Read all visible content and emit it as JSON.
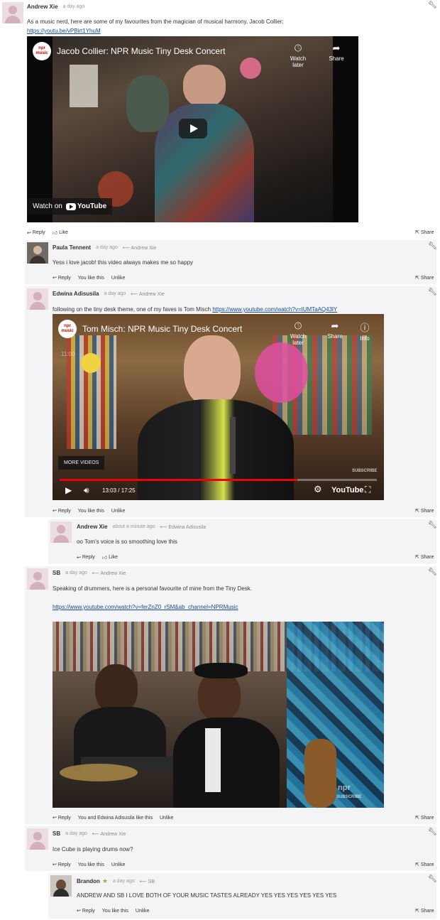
{
  "icons": {
    "reply": "reply-icon",
    "like": "thumbs-up-icon",
    "share": "share-icon",
    "settings": "wrench-icon"
  },
  "colors": {
    "link": "#1a4b8f",
    "shaded_bg": "#f4f4f6",
    "progress": "#e00000"
  },
  "posts": [
    {
      "author": "Andrew Xie",
      "time": "a day ago",
      "text": "As a music nerd, here are some of my favourites from the magician of musical harmony, Jacob Collier:",
      "link": "https://youtu.be/vPBirt1YhuM",
      "video": {
        "title": "Jacob Collier: NPR Music Tiny Desk Concert",
        "logo": "npr music",
        "watch_later": "Watch later",
        "share": "Share",
        "watch_on": "Watch on",
        "youtube": "YouTube"
      },
      "actions": {
        "reply": "Reply",
        "like": "Like"
      },
      "share": "Share"
    },
    {
      "author": "Paula Tennent",
      "time": "a day ago",
      "parent": "Andrew Xie",
      "text": "Yess i love jacob! this video always makes me so happy",
      "actions": {
        "reply": "Reply",
        "likes": "You like this",
        "unlike": "Unlike"
      },
      "share": "Share"
    },
    {
      "author": "Edwina Adisusila",
      "time": "a day ago",
      "parent": "Andrew Xie",
      "text": "following on the tiny desk theme, one of my faves is Tom Misch",
      "link": "https://www.youtube.com/watch?v=IUMTaAQ43lY",
      "video": {
        "title": "Tom Misch: NPR Music Tiny Desk Concert",
        "logo": "npr music",
        "watch_later": "Watch later",
        "share": "Share",
        "info": "Info",
        "more_videos": "MORE VIDEOS",
        "time": "13:03 / 17:25",
        "youtube": "YouTube",
        "subscribe": "SUBSCRIBE",
        "overlay_time": "11:00",
        "progress": 0.75
      },
      "actions": {
        "reply": "Reply",
        "likes": "You like this",
        "unlike": "Unlike"
      },
      "share": "Share"
    },
    {
      "author": "Andrew Xie",
      "time": "about a minute ago",
      "parent": "Edwina Adisusila",
      "text": "oo Tom's voice is so smoothing love this",
      "actions": {
        "reply": "Reply",
        "like": "Like"
      },
      "share": "Share"
    },
    {
      "author": "SB",
      "time": "a day ago",
      "parent": "Andrew Xie",
      "text": "Speaking of drummers, here is a personal favourite of mine from the Tiny Desk.",
      "link": "https://www.youtube.com/watch?v=ferZnZ0_rSM&ab_channel=NPRMusic",
      "video": {
        "watermark": "npr",
        "subscribe": "SUBSCRIBE"
      },
      "actions": {
        "reply": "Reply",
        "likes": "You and Edwina Adisusila like this",
        "unlike": "Unlike"
      },
      "share": "Share"
    },
    {
      "author": "SB",
      "time": "a day ago",
      "parent": "Andrew Xie",
      "text": "Ice Cube is playing drums now?",
      "actions": {
        "reply": "Reply",
        "likes": "You like this",
        "unlike": "Unlike"
      },
      "share": "Share"
    },
    {
      "author": "Brandon",
      "time": "a day ago",
      "parent": "SB",
      "text": "ANDREW AND SB I LOVE BOTH OF YOUR MUSIC TASTES ALREADY YES YES YES YES YES YES",
      "actions": {
        "reply": "Reply",
        "likes": "You like this",
        "unlike": "Unlike"
      },
      "share": "Share"
    }
  ]
}
